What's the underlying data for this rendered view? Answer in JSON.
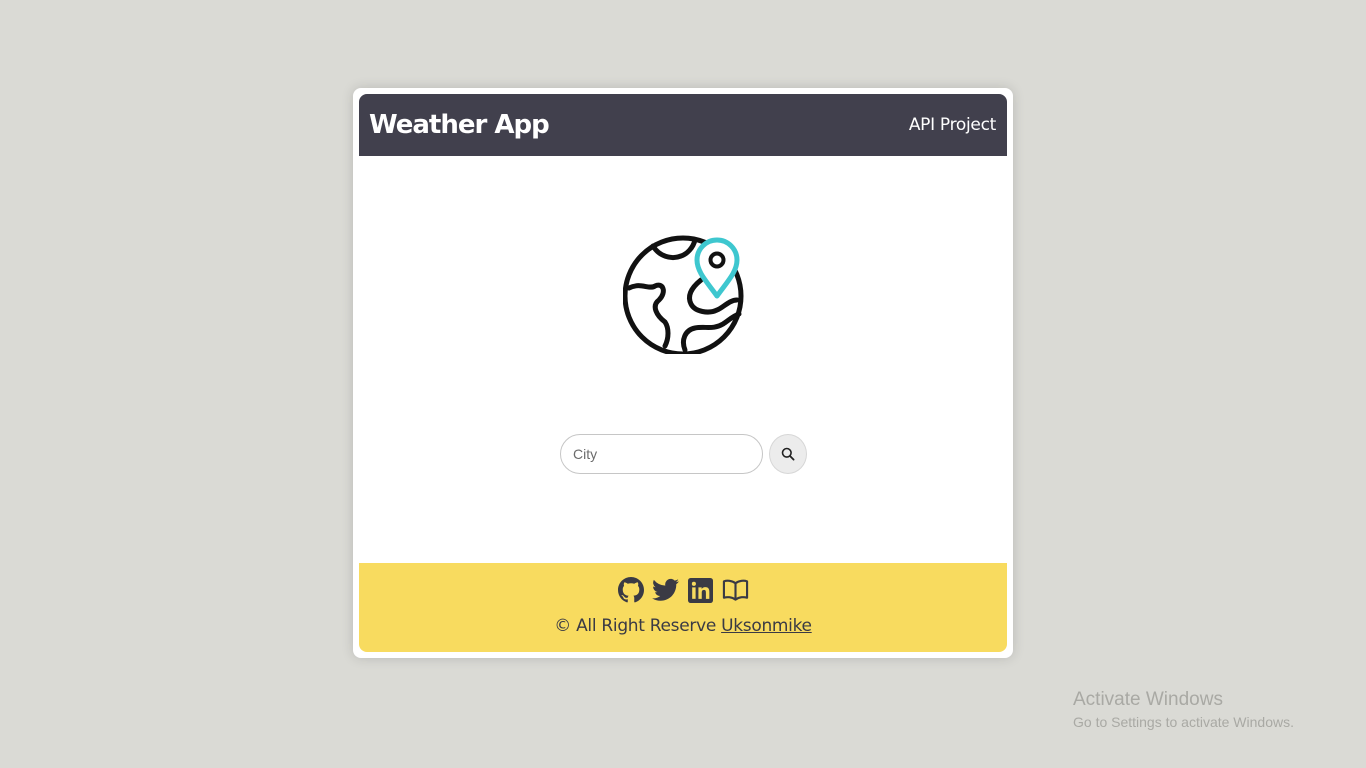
{
  "header": {
    "title": "Weather App",
    "subtitle": "API Project"
  },
  "search": {
    "placeholder": "City",
    "value": ""
  },
  "footer": {
    "icons": [
      "github-icon",
      "twitter-icon",
      "linkedin-icon",
      "book-icon"
    ],
    "copyright_text": "© All Right Reserve ",
    "author_link": "Uksonmike"
  },
  "colors": {
    "header_bg": "#41404d",
    "footer_bg": "#f8db5f",
    "pin_accent": "#3ec7cf",
    "page_bg": "#dadad5"
  },
  "watermark": {
    "line1": "Activate Windows",
    "line2": "Go to Settings to activate Windows."
  }
}
